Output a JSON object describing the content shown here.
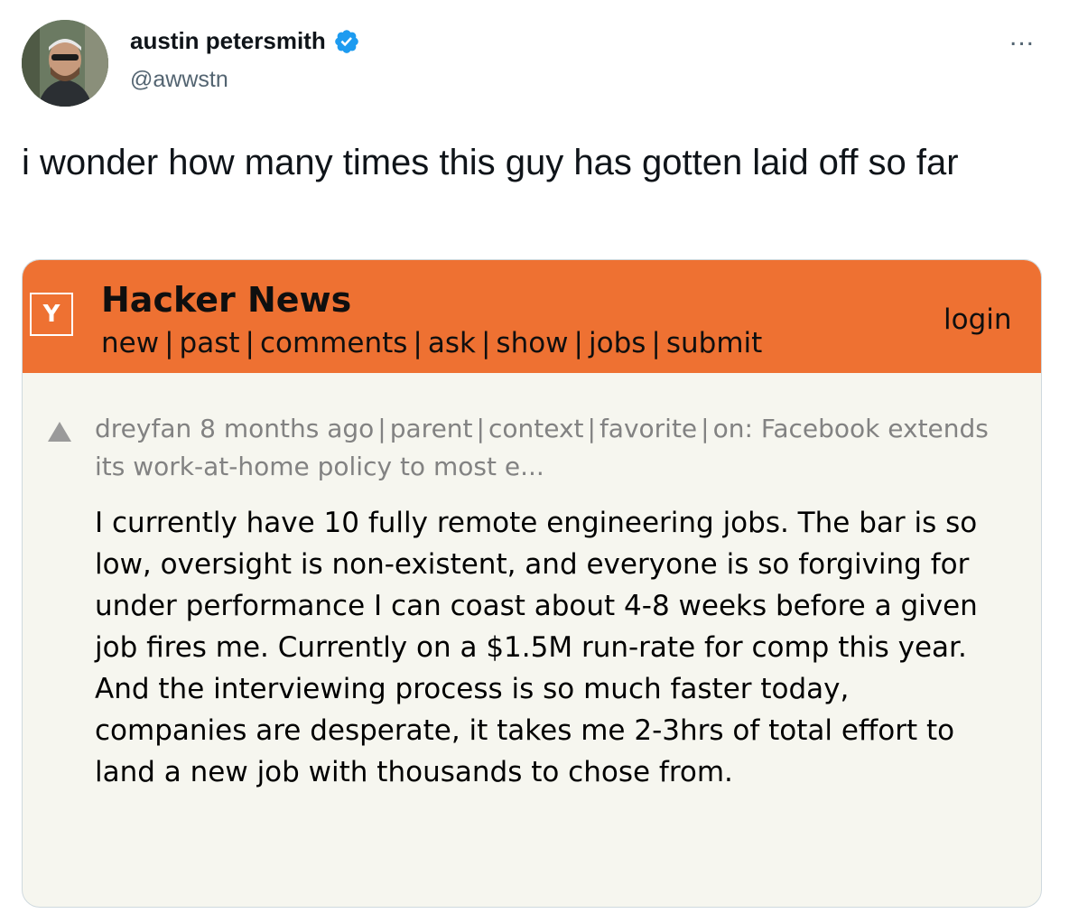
{
  "tweet": {
    "author_name": "austin petersmith",
    "handle": "@awwstn",
    "more_label": "...",
    "text": "i wonder how many times this guy has gotten laid off so far",
    "colors": {
      "verified": "#1d9bf0",
      "text": "#0f1419",
      "secondary": "#536471"
    }
  },
  "hn": {
    "logo": "Y",
    "title": "Hacker News",
    "nav": [
      "new",
      "past",
      "comments",
      "ask",
      "show",
      "jobs",
      "submit"
    ],
    "login": "login",
    "colors": {
      "header": "#ee7132",
      "background": "#f6f6ef",
      "meta": "#828282"
    },
    "comment": {
      "user": "dreyfan",
      "age": "8 months ago",
      "links": [
        "parent",
        "context",
        "favorite"
      ],
      "on_prefix": "on:",
      "on_title": "Facebook extends its work-at-home policy to most e...",
      "body": "I currently have 10 fully remote engineering jobs. The bar is so low, oversight is non-existent, and everyone is so forgiving for under performance I can coast about 4-8 weeks before a given job fires me. Currently on a $1.5M run-rate for comp this year. And the interviewing process is so much faster today, companies are desperate, it takes me 2-3hrs of total effort to land a new job with thousands to chose from."
    }
  }
}
